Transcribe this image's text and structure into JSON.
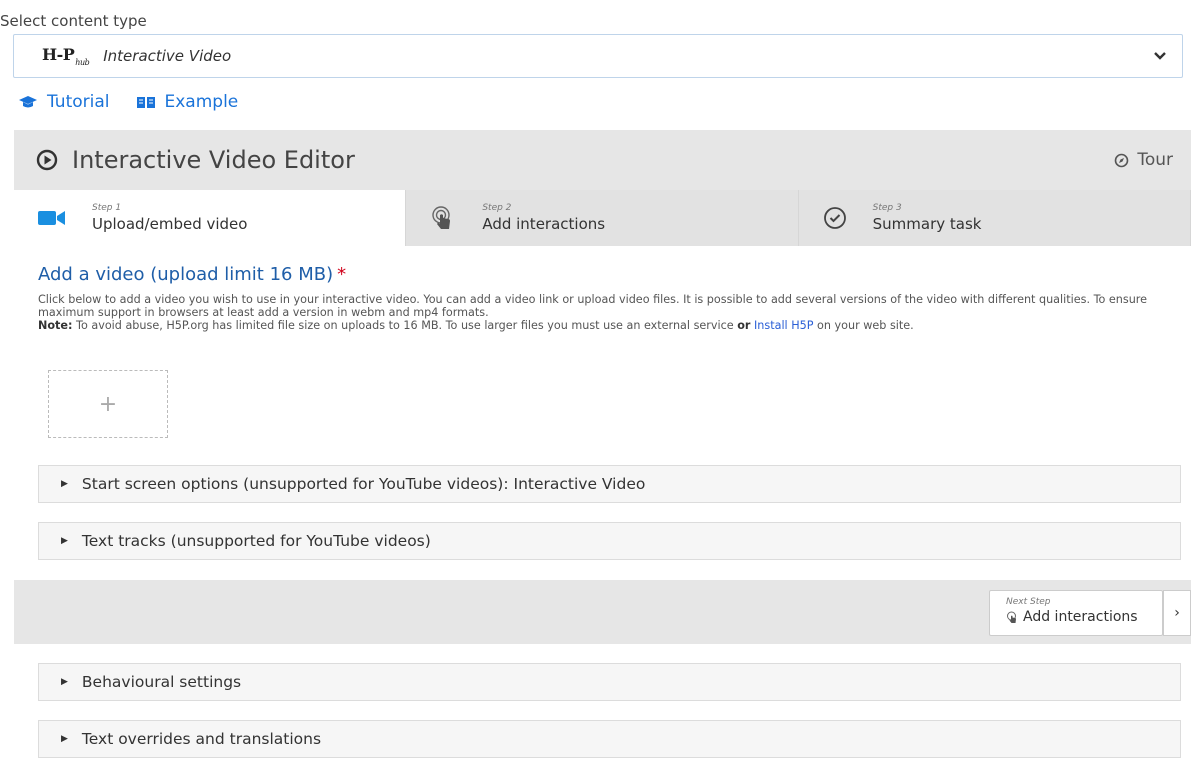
{
  "content_type": {
    "label": "Select content type",
    "logo_text": "H-P",
    "logo_sub": "hub",
    "selected": "Interactive Video"
  },
  "links": {
    "tutorial": "Tutorial",
    "example": "Example"
  },
  "editor": {
    "title": "Interactive Video Editor",
    "tour": "Tour"
  },
  "steps": [
    {
      "small": "Step 1",
      "name": "Upload/embed video",
      "icon": "video-camera-icon"
    },
    {
      "small": "Step 2",
      "name": "Add interactions",
      "icon": "touch-icon"
    },
    {
      "small": "Step 3",
      "name": "Summary task",
      "icon": "check-circle-icon"
    }
  ],
  "video_section": {
    "title": "Add a video (upload limit 16 MB)",
    "required_mark": "*",
    "description_1": "Click below to add a video you wish to use in your interactive video. You can add a video link or upload video files. It is possible to add several versions of the video with different qualities. To ensure maximum support in browsers at least add a version in webm and mp4 formats.",
    "note_label": "Note:",
    "description_2": " To avoid abuse, H5P.org has limited file size on uploads to 16 MB. To use larger files you must use an external service ",
    "or_word": "or",
    "install_link": "Install H5P",
    "description_3": " on your web site.",
    "add_symbol": "+"
  },
  "panels": {
    "start_screen": "Start screen options (unsupported for YouTube videos): Interactive Video",
    "text_tracks": "Text tracks (unsupported for YouTube videos)",
    "behavioural": "Behavioural settings",
    "text_overrides": "Text overrides and translations"
  },
  "next_step": {
    "small": "Next Step",
    "name": "Add interactions",
    "arrow": "›"
  },
  "colors": {
    "link": "#1a73d9",
    "title": "#1f5ea8",
    "video_icon": "#1a8fe0",
    "required": "#d0021b"
  }
}
